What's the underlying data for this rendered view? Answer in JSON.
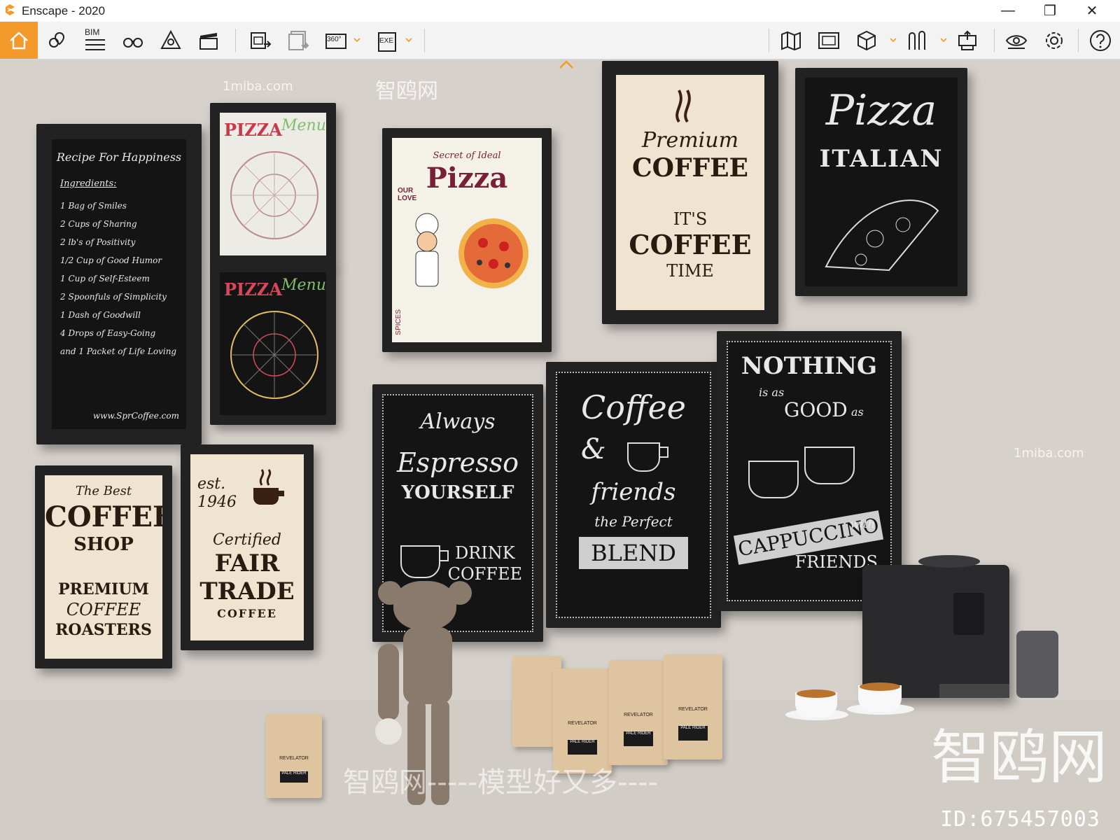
{
  "window": {
    "title": "Enscape - 2020",
    "controls": [
      "—",
      "❐",
      "✕"
    ]
  },
  "toolbar": {
    "bim_label": "BIM",
    "panorama_label": "360°",
    "exe_label": "EXE"
  },
  "scene": {
    "recipe": {
      "title": "Recipe For Happiness",
      "heading": "Ingredients:",
      "lines": [
        "1 Bag of Smiles",
        "2 Cups of Sharing",
        "2 lb's of Positivity",
        "1/2 Cup of Good Humor",
        "1 Cup of Self-Esteem",
        "2 Spoonfuls of Simplicity",
        "1 Dash of Goodwill",
        "4 Drops of Easy-Going",
        "and 1 Packet of Life Loving"
      ],
      "url": "www.SprCoffee.com"
    },
    "pizza_menu": {
      "title_a": "PIZZA",
      "title_b": "Menu"
    },
    "ideal_pizza": {
      "top": "Secret of Ideal",
      "word": "Pizza",
      "side": "OUR LOVE",
      "spices": "SPICES"
    },
    "premium": {
      "line1": "Premium",
      "line2": "COFFEE",
      "line3": "IT'S",
      "line4": "COFFEE",
      "line5": "TIME"
    },
    "pizza_italian": {
      "line1": "Pizza",
      "line2": "ITALIAN"
    },
    "coffee_shop": {
      "line1": "The Best",
      "line2": "COFFEE",
      "line3": "SHOP",
      "line4": "PREMIUM",
      "line5": "COFFEE",
      "line6": "ROASTERS"
    },
    "fair_trade": {
      "line1": "est.",
      "line2": "1946",
      "line3": "Certified",
      "line4": "FAIR",
      "line5": "TRADE",
      "line6": "COFFEE"
    },
    "espresso": {
      "line1": "Always",
      "line2": "Espresso",
      "line3": "YOURSELF",
      "line4": "DRINK",
      "line5": "COFFEE"
    },
    "friends": {
      "line1": "Coffee",
      "line2": "&",
      "line3": "friends",
      "line4": "the Perfect",
      "line5": "BLEND"
    },
    "nothing": {
      "line1": "NOTHING",
      "line2": "is as",
      "line3": "GOOD",
      "line4": "as",
      "line5": "CAPPUCCINO",
      "line6": "with",
      "line7": "FRIENDS"
    },
    "bag": {
      "brand": "REVELATOR",
      "product": "PALE RIDER"
    }
  },
  "watermark": {
    "site": "1miba.com",
    "cn_small": "智鸥网",
    "cn_big": "智鸥网",
    "bottom": "智鸥网-----模型好又多----",
    "id": "ID:675457003"
  },
  "colors": {
    "accent": "#f39a2a",
    "wall": "#d7d1cc",
    "chalkboard": "#141414",
    "paper": "#efe4cf"
  }
}
